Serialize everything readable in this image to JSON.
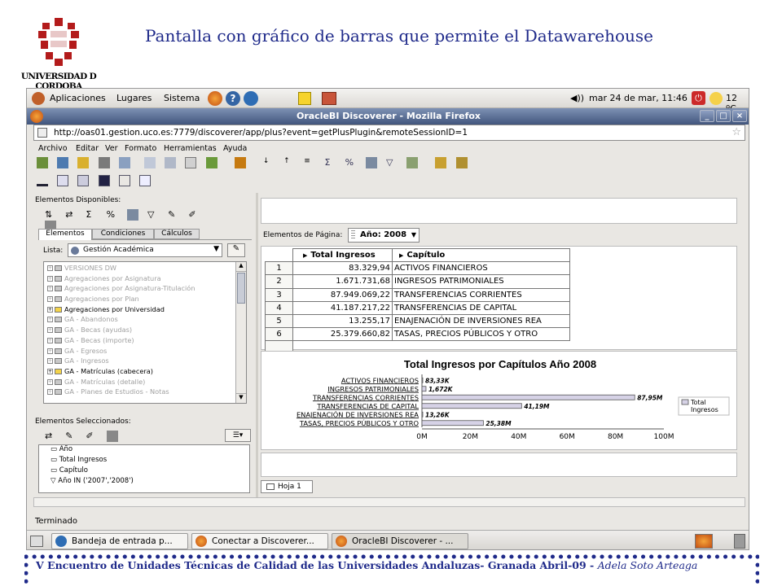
{
  "slide": {
    "title": "Pantalla con gráfico de barras que permite el Datawarehouse",
    "logo_text": "UNIVERSIDAD D CORDOBA",
    "footer": "V Encuentro de Unidades Técnicas de Calidad de las Universidades Andaluzas- Granada Abril-09 -",
    "footer_author": "Adela Soto Arteaga"
  },
  "desktop": {
    "menus": [
      "Aplicaciones",
      "Lugares",
      "Sistema"
    ],
    "clock": "mar 24 de mar, 11:46",
    "temperature": "12 ºC"
  },
  "window": {
    "title": "OracleBI Discoverer - Mozilla Firefox",
    "url": "http://oas01.gestion.uco.es:7779/discoverer/app/plus?event=getPlusPlugin&remoteSessionID=1",
    "menu": [
      "Archivo",
      "Editar",
      "Ver",
      "Formato",
      "Herramientas",
      "Ayuda"
    ]
  },
  "left_panel": {
    "available_label": "Elementos Disponibles:",
    "tabs": [
      "Elementos",
      "Condiciones",
      "Cálculos"
    ],
    "list_label": "Lista:",
    "list_value": "Gestión Académica",
    "tree": [
      {
        "label": "VERSIONES DW",
        "active": false
      },
      {
        "label": "Agregaciones por Asignatura",
        "active": false
      },
      {
        "label": "Agregaciones por Asignatura-Titulación",
        "active": false
      },
      {
        "label": "Agregaciones por Plan",
        "active": false
      },
      {
        "label": "Agregaciones por Universidad",
        "active": true
      },
      {
        "label": "GA - Abandonos",
        "active": false
      },
      {
        "label": "GA - Becas (ayudas)",
        "active": false
      },
      {
        "label": "GA - Becas (importe)",
        "active": false
      },
      {
        "label": "GA - Egresos",
        "active": false
      },
      {
        "label": "GA - Ingresos",
        "active": false
      },
      {
        "label": "GA - Matrículas (cabecera)",
        "active": true
      },
      {
        "label": "GA - Matrículas (detalle)",
        "active": false
      },
      {
        "label": "GA - Planes de Estudios - Notas",
        "active": false
      }
    ],
    "selected_label": "Elementos Seleccionados:",
    "selected": [
      "Año",
      "Total Ingresos",
      "Capítulo",
      "Año IN ('2007','2008')"
    ]
  },
  "right_panel": {
    "page_items_label": "Elementos de Página:",
    "year_selector": "Año: 2008",
    "table_headers": [
      "Total Ingresos",
      "Capítulo"
    ],
    "rows": [
      {
        "n": "1",
        "total": "83.329,94",
        "capitulo": "ACTIVOS FINANCIEROS"
      },
      {
        "n": "2",
        "total": "1.671.731,68",
        "capitulo": "INGRESOS PATRIMONIALES"
      },
      {
        "n": "3",
        "total": "87.949.069,22",
        "capitulo": "TRANSFERENCIAS CORRIENTES"
      },
      {
        "n": "4",
        "total": "41.187.217,22",
        "capitulo": "TRANSFERENCIAS DE CAPITAL"
      },
      {
        "n": "5",
        "total": "13.255,17",
        "capitulo": "ENAJENACIÓN DE INVERSIONES REA"
      },
      {
        "n": "6",
        "total": "25.379.660,82",
        "capitulo": "TASAS, PRECIOS PÚBLICOS Y OTRO"
      }
    ],
    "sheet_tab": "Hoja 1"
  },
  "chart_data": {
    "type": "bar",
    "orientation": "horizontal",
    "title": "Total Ingresos por Capítulos Año 2008",
    "categories": [
      "ACTIVOS FINANCIEROS",
      "INGRESOS PATRIMONIALES",
      "TRANSFERENCIAS CORRIENTES",
      "TRANSFERENCIAS DE CAPITAL",
      "ENAJENACIÓN DE INVERSIONES REA",
      "TASAS, PRECIOS PÚBLICOS Y OTRO"
    ],
    "series": [
      {
        "name": "Total Ingresos",
        "values": [
          83329.94,
          1671731.68,
          87949069.22,
          41187217.22,
          13255.17,
          25379660.82
        ]
      }
    ],
    "data_labels": [
      "83,33K",
      "1,672K",
      "87,95M",
      "41,19M",
      "13,26K",
      "25,38M"
    ],
    "x_ticks": [
      "0M",
      "20M",
      "40M",
      "60M",
      "80M",
      "100M"
    ],
    "xlim": [
      0,
      100000000
    ],
    "legend": "right",
    "bar_color": "#d6d2e6"
  },
  "status": "Terminado",
  "taskbar": [
    "Bandeja de entrada p...",
    "Conectar a Discoverer...",
    "OracleBI Discoverer - ..."
  ]
}
